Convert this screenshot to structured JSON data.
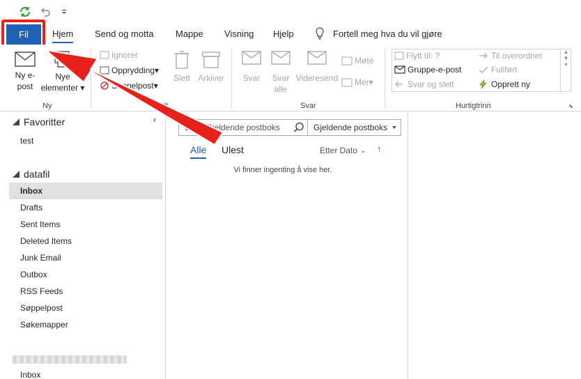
{
  "quick_access": {
    "sync_icon": "sync-icon",
    "undo_icon": "undo-icon",
    "customize_icon": "customize-icon"
  },
  "tabs": {
    "file": "Fil",
    "items": [
      "Hjem",
      "Send og motta",
      "Mappe",
      "Visning",
      "Hjelp"
    ],
    "tell_me": "Fortell meg hva du vil gjøre"
  },
  "ribbon": {
    "new": {
      "new_email": [
        "Ny e-",
        "post"
      ],
      "new_items": [
        "Nye",
        "elementer"
      ],
      "label": "Ny"
    },
    "delete": {
      "ignore": "Ignorer",
      "cleanup": "Opprydding",
      "junk": "Søppelpost",
      "delete": "Slett",
      "archive": "Arkiver",
      "label_fragment": "Slett"
    },
    "respond": {
      "reply": "Svar",
      "reply_all": [
        "Svar",
        "alle"
      ],
      "forward": "Videresend",
      "meeting": "Møte",
      "more": "Mer",
      "label": "Svar"
    },
    "quick_steps": {
      "move_to": "Flytt til: ?",
      "team_email": "Gruppe-e-post",
      "reply_delete": "Svar og slett",
      "to_manager": "Til overordnet",
      "done": "Fullført",
      "create_new": "Opprett ny",
      "label": "Hurtigtrinn"
    }
  },
  "folder_pane": {
    "favorites": "Favoritter",
    "favorites_items": [
      "test"
    ],
    "account": "datafil",
    "folders": [
      "Inbox",
      "Drafts",
      "Sent Items",
      "Deleted Items",
      "Junk Email",
      "Outbox",
      "RSS Feeds",
      "Søppelpost",
      "Søkemapper"
    ],
    "second_account_inbox": "Inbox"
  },
  "message_list": {
    "search_placeholder": "Søk i Gjeldende postboks",
    "scope": "Gjeldende postboks",
    "filter_all": "Alle",
    "filter_unread": "Ulest",
    "sort": "Etter Dato",
    "empty_text": "Vi finner ingenting å vise her."
  },
  "colors": {
    "accent": "#1f62b4",
    "highlight": "#e8211b"
  }
}
